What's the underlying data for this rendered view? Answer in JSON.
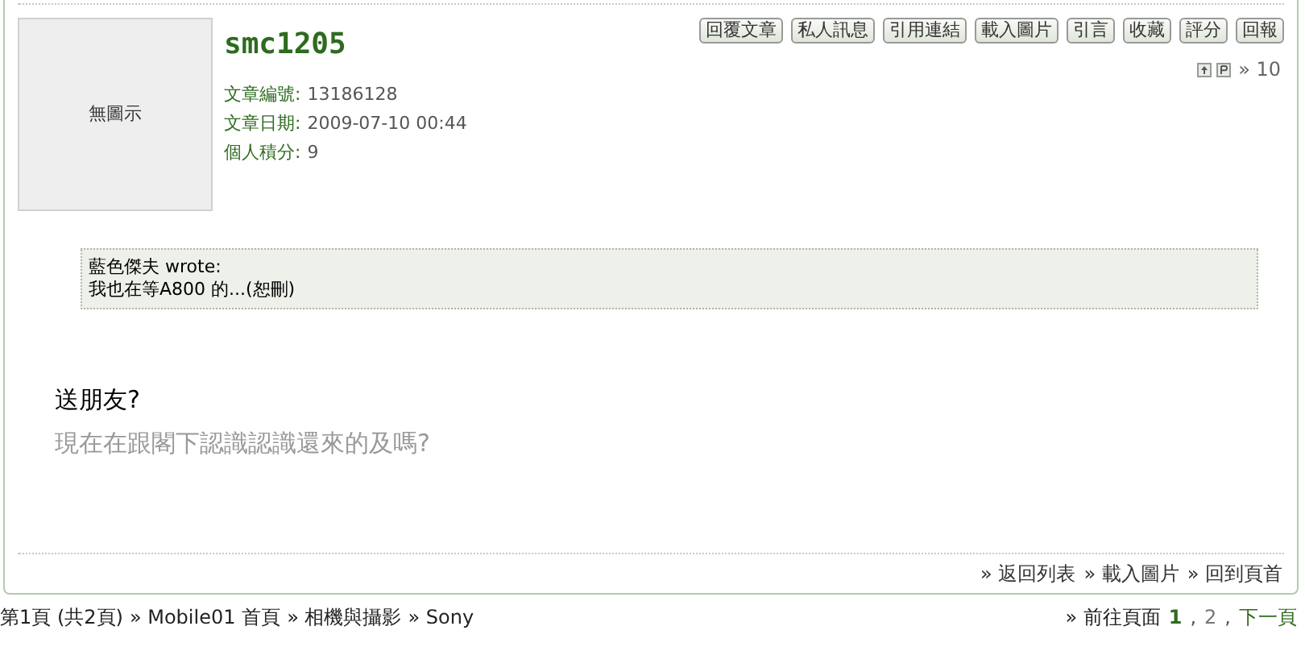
{
  "post": {
    "avatar_placeholder": "無圖示",
    "username": "smc1205",
    "info": [
      {
        "label": "文章編號:",
        "value": "13186128"
      },
      {
        "label": "文章日期:",
        "value": "2009-07-10 00:44"
      },
      {
        "label": "個人積分:",
        "value": "9"
      }
    ],
    "actions": [
      "回覆文章",
      "私人訊息",
      "引用連結",
      "載入圖片",
      "引言",
      "收藏",
      "評分",
      "回報"
    ],
    "floor": "» 10",
    "quote": {
      "author": "藍色傑夫 wrote:",
      "text": "我也在等A800 的...(恕刪)"
    },
    "body": [
      {
        "text": "送朋友?",
        "muted": false
      },
      {
        "text": "現在在跟閣下認識認識還來的及嗎?",
        "muted": true
      }
    ],
    "footer_links": [
      "» 返回列表",
      "» 載入圖片",
      "» 回到頁首"
    ]
  },
  "breadcrumb": [
    "第1頁 (共2頁)",
    "» Mobile01 首頁",
    "» 相機與攝影",
    "» Sony"
  ],
  "pagination": {
    "label": "» 前往頁面",
    "items": [
      {
        "kind": "page",
        "label": "1",
        "selected": true
      },
      {
        "kind": "sep",
        "label": ","
      },
      {
        "kind": "page",
        "label": "2",
        "selected": false
      },
      {
        "kind": "sep",
        "label": ","
      },
      {
        "kind": "next",
        "label": "下一頁"
      }
    ]
  }
}
